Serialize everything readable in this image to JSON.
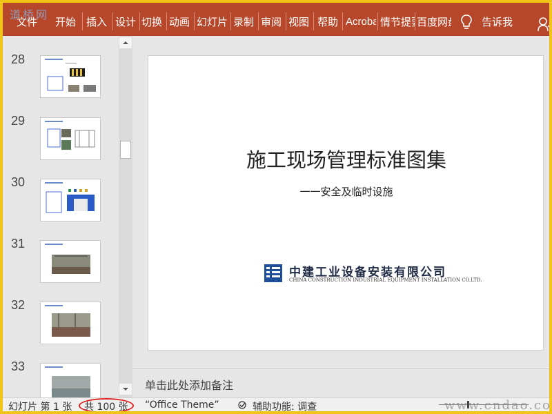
{
  "ribbon": {
    "watermark": "道桥网",
    "tabs": [
      "文件",
      "开始",
      "插入",
      "设计",
      "切换",
      "动画",
      "幻灯片",
      "录制",
      "审阅",
      "视图",
      "帮助",
      "Acrobat",
      "情节提要",
      "百度网盘"
    ],
    "tell_me": "告诉我",
    "accent_color": "#b7472a"
  },
  "thumbnails": [
    {
      "number": "28"
    },
    {
      "number": "29"
    },
    {
      "number": "30"
    },
    {
      "number": "31"
    },
    {
      "number": "32"
    },
    {
      "number": "33"
    }
  ],
  "slide": {
    "title": "施工现场管理标准图集",
    "subtitle": "一一安全及临时设施",
    "company_cn": "中建工业设备安装有限公司",
    "company_en": "CHINA CONSTRUCTION INDUSTRIAL EQUIPMENT INSTALLATION CO.LTD."
  },
  "notes": {
    "placeholder": "单击此处添加备注"
  },
  "status": {
    "slide_info": "幻灯片 第 1 张",
    "total": "共 100 张",
    "theme": "“Office Theme”",
    "accessibility": "辅助功能: 调查",
    "watermark": "www.cndao.com"
  }
}
